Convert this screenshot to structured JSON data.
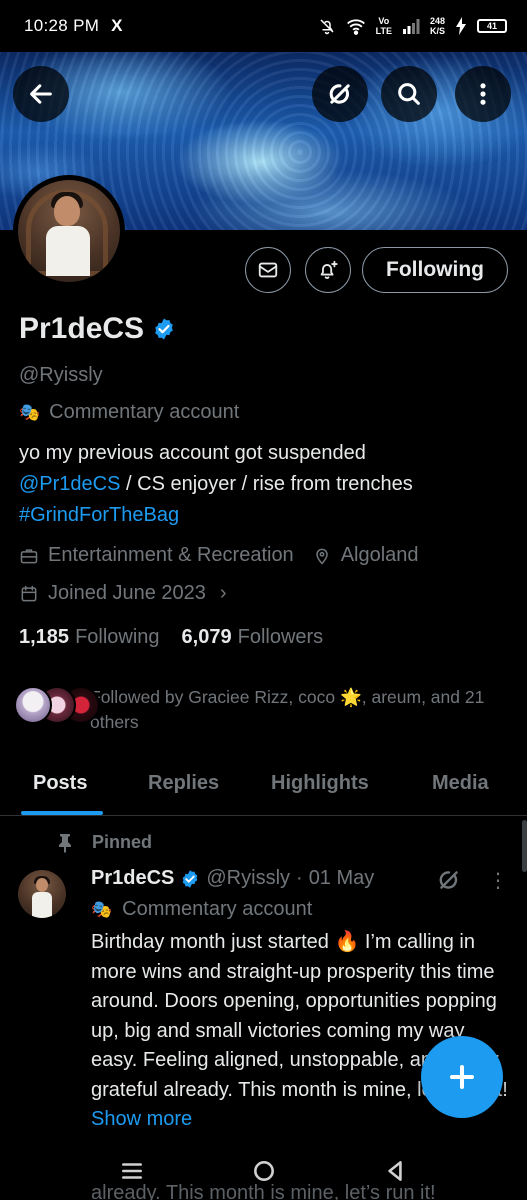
{
  "status_bar": {
    "time": "10:28 PM",
    "app_icon": "X",
    "network_top": "Vo",
    "network_bottom": "LTE",
    "speed_top": "248",
    "speed_bottom": "K/S",
    "battery": "41"
  },
  "header": {
    "back_icon": "arrow-left-icon",
    "grok_icon": "grok-icon",
    "search_icon": "search-icon",
    "more_icon": "more-vertical-icon"
  },
  "profile": {
    "name": "Pr1deCS",
    "handle": "@Ryissly",
    "category_icon": "theater-mask",
    "category": "Commentary account",
    "bio_line1": "yo my previous account got suspended",
    "bio_mention": "@Pr1deCS",
    "bio_line2_rest": " / CS enjoyer / rise from trenches",
    "bio_hashtag": "#GrindForTheBag",
    "profession": "Entertainment & Recreation",
    "location": "Algoland",
    "joined": "Joined June 2023",
    "following_count": "1,185",
    "following_label": "Following",
    "followers_count": "6,079",
    "followers_label": "Followers",
    "followed_by": "Followed by Graciee Rizz, coco 🌟, areum, and 21 others",
    "follow_button": "Following"
  },
  "tabs": [
    {
      "label": "Posts",
      "active": true
    },
    {
      "label": "Replies",
      "active": false
    },
    {
      "label": "Highlights",
      "active": false
    },
    {
      "label": "Media",
      "active": false
    }
  ],
  "pinned_post": {
    "pinned_label": "Pinned",
    "author_name": "Pr1deCS",
    "author_handle": "@Ryissly",
    "dot": "·",
    "date": "01 May",
    "category": "Commentary account",
    "text": "Birthday month just started 🔥 I’m calling in more wins and straight-up prosperity this time around. Doors opening, opportunities popping up, big and small victories coming my way easy. Feeling aligned, unstoppable, and super grateful already. This month is mine, let’s run it!",
    "show_more": "Show more",
    "ghost_line": "already. This month is mine, let’s run it!"
  },
  "colors": {
    "accent": "#1d9bf0",
    "background": "#000000",
    "text_primary": "#e7e9ea",
    "text_secondary": "#71767b"
  }
}
